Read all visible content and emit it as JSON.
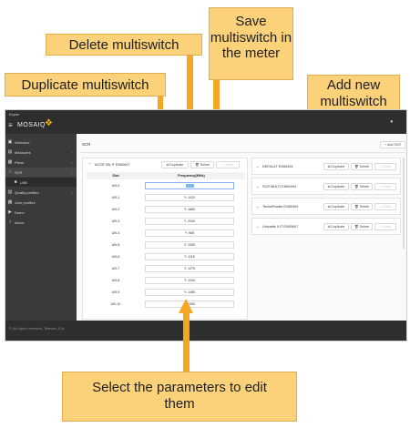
{
  "callouts": {
    "delete": "Delete multiswitch",
    "save": "Save multiswitch in the meter",
    "add_new": "Add new multiswitch",
    "duplicate": "Duplicate multiswitch",
    "select_params": "Select the parameters to edit them"
  },
  "app": {
    "small_title": "Expler",
    "brand": "MOSAIQ",
    "footer": "© All rights reserved, Televes, S.A.",
    "sidebar": [
      {
        "label": "Welcome",
        "icon": "home-icon"
      },
      {
        "label": "Measures",
        "icon": "chart-icon"
      },
      {
        "label": "Plans",
        "icon": "grid-icon"
      },
      {
        "label": "SCR",
        "icon": "circle-icon"
      },
      {
        "label": "LNB",
        "icon": "dish-icon"
      },
      {
        "label": "Quality profiles",
        "icon": "list-icon"
      },
      {
        "label": "User profiles",
        "icon": "user-icon"
      },
      {
        "label": "Demo",
        "icon": "play-icon"
      },
      {
        "label": "About",
        "icon": "info-icon"
      }
    ],
    "section_title": "SCR",
    "add_button": "+ Add SCR",
    "left_panel": {
      "title": "ACSS SW IT EN50607",
      "duplicate": "Duplicate",
      "delete": "Delete",
      "save": "Save",
      "col_slot": "Slot",
      "col_freq": "Frequency(MHz)",
      "rows": [
        {
          "slot": "UB-0",
          "freq": ""
        },
        {
          "slot": "UB-1",
          "freq": "1420"
        },
        {
          "slot": "UB-2",
          "freq": "1680"
        },
        {
          "slot": "UB-3",
          "freq": "2040"
        },
        {
          "slot": "UB-4",
          "freq": "985"
        },
        {
          "slot": "UB-5",
          "freq": "1050"
        },
        {
          "slot": "UB-6",
          "freq": "1115"
        },
        {
          "slot": "UB-7",
          "freq": "1275"
        },
        {
          "slot": "UB-8",
          "freq": "1340"
        },
        {
          "slot": "UB-9",
          "freq": "1485"
        },
        {
          "slot": "UB-10",
          "freq": "1550"
        }
      ]
    },
    "right_list": [
      {
        "title": "DEFAULT EN50494"
      },
      {
        "title": "SCR MULTI EN50494"
      },
      {
        "title": "TechniRouter EN50494"
      },
      {
        "title": "Unicable II IT EN50607"
      }
    ],
    "btn_duplicate": "Duplicate",
    "btn_delete": "Delete",
    "btn_save": "Save"
  }
}
